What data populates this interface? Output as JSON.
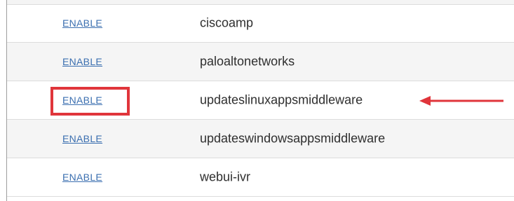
{
  "rows": [
    {
      "action_label": "ENABLE",
      "name": "ciscoamp"
    },
    {
      "action_label": "ENABLE",
      "name": "paloaltonetworks"
    },
    {
      "action_label": "ENABLE",
      "name": "updateslinuxappsmiddleware"
    },
    {
      "action_label": "ENABLE",
      "name": "updateswindowsappsmiddleware"
    },
    {
      "action_label": "ENABLE",
      "name": "webui-ivr"
    }
  ],
  "annotation": {
    "highlighted_row": "updateslinuxappsmiddleware",
    "color": "#e0353b"
  },
  "colors": {
    "link": "#3b6fb0",
    "text": "#2f2f2f",
    "alt_row": "#f5f5f5"
  }
}
